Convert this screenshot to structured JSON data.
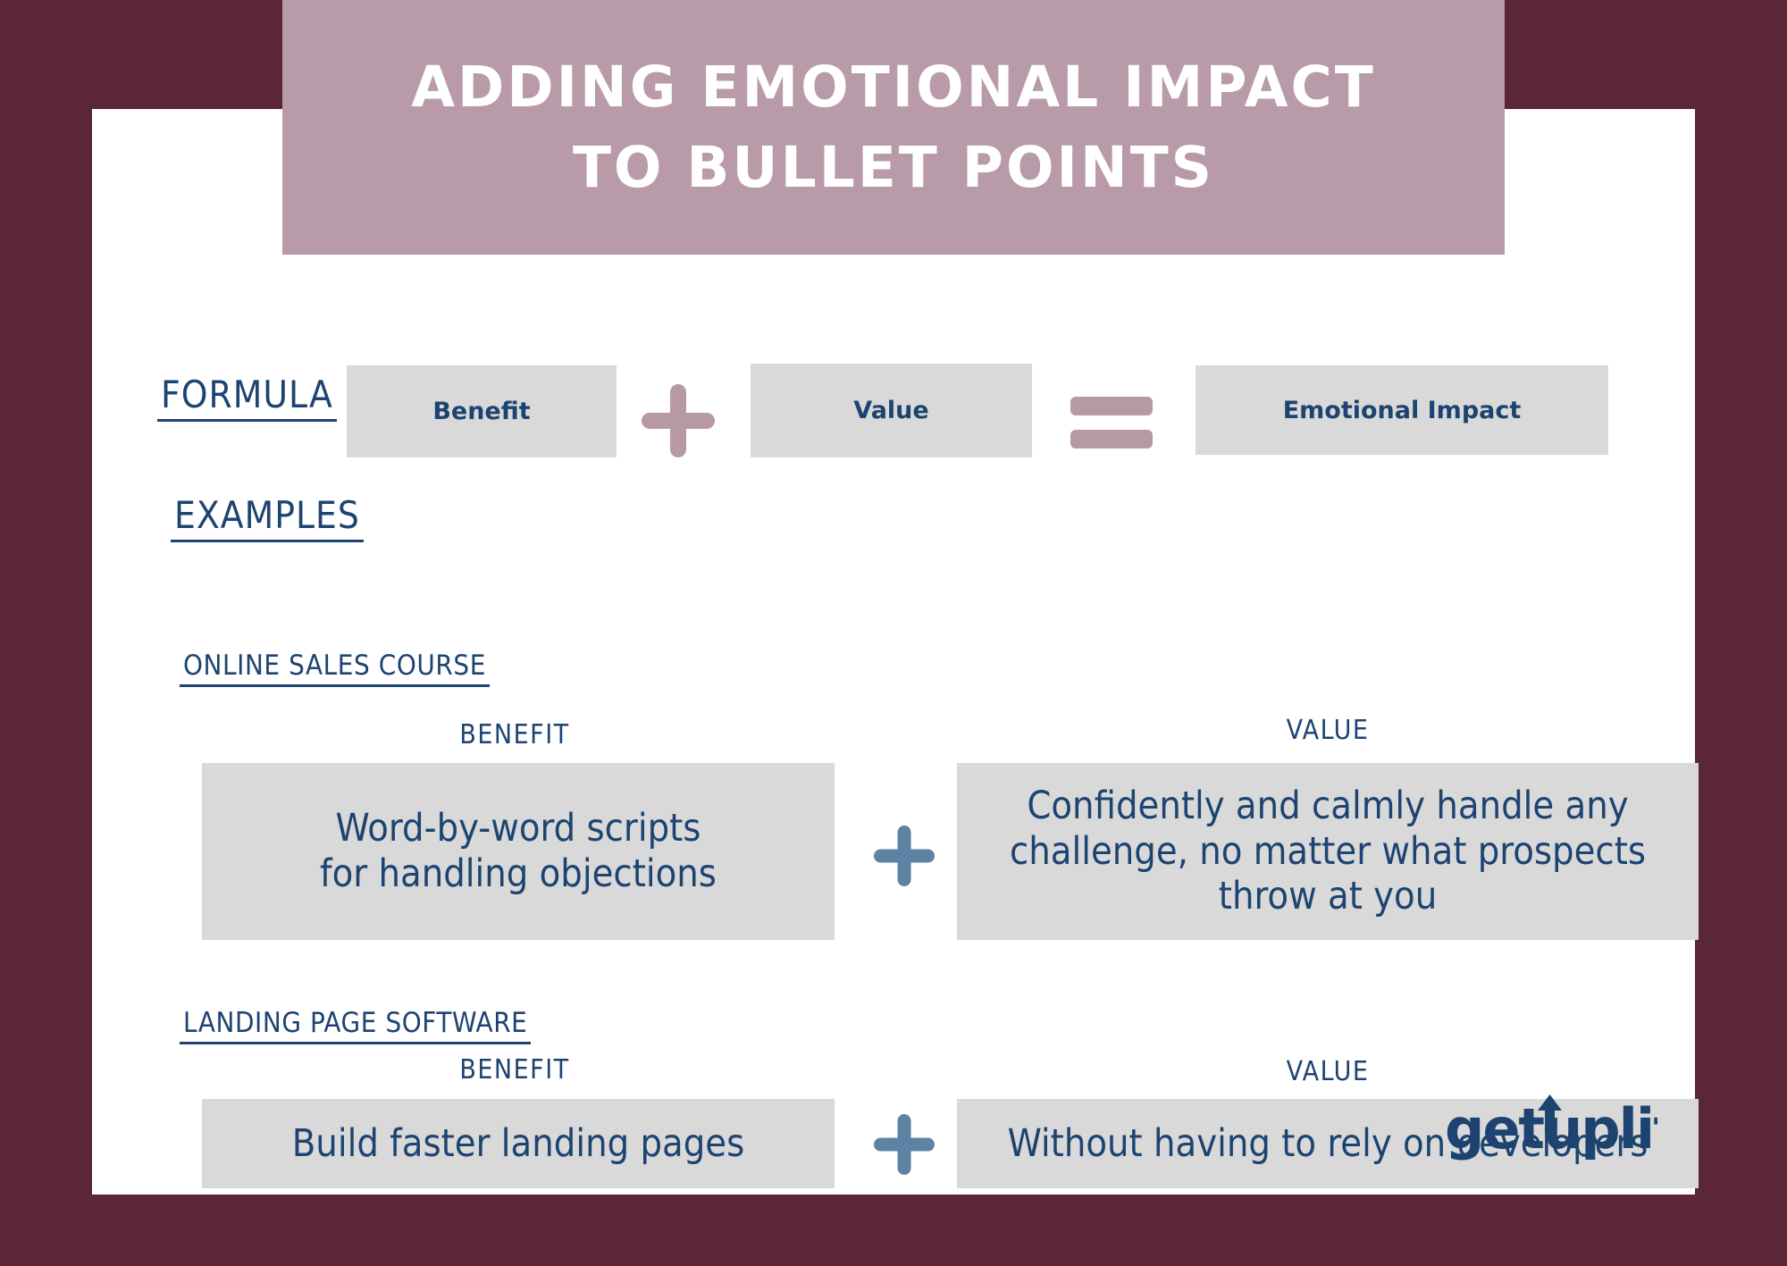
{
  "theme": {
    "background": "#5c2639",
    "card": "#ffffff",
    "banner": "#b99aa8",
    "box": "#d9d9d9",
    "navy": "#1d4471",
    "rose": "#b799a3",
    "steel": "#5d82a3"
  },
  "banner": {
    "line1": "ADDING EMOTIONAL IMPACT",
    "line2": "TO BULLET POINTS"
  },
  "formula": {
    "label": "FORMULA",
    "benefit": "Benefit",
    "plus_symbol": "+",
    "value": "Value",
    "equals_symbol": "=",
    "result": "Emotional Impact"
  },
  "examples": {
    "label": "EXAMPLES",
    "items": [
      {
        "title": "ONLINE SALES COURSE",
        "benefit_head": "BENEFIT",
        "value_head": "VALUE",
        "plus_symbol": "+",
        "benefit_text": "Word-by-word scripts\nfor handling objections",
        "value_text": "Confidently and calmly handle any challenge, no matter what prospects throw at you"
      },
      {
        "title": "LANDING PAGE SOFTWARE",
        "benefit_head": "BENEFIT",
        "value_head": "VALUE",
        "plus_symbol": "+",
        "benefit_text": "Build faster landing pages",
        "value_text": "Without having to rely on developers"
      }
    ]
  },
  "logo": {
    "text": "getuplift",
    "icon": "up-arrow-icon"
  }
}
